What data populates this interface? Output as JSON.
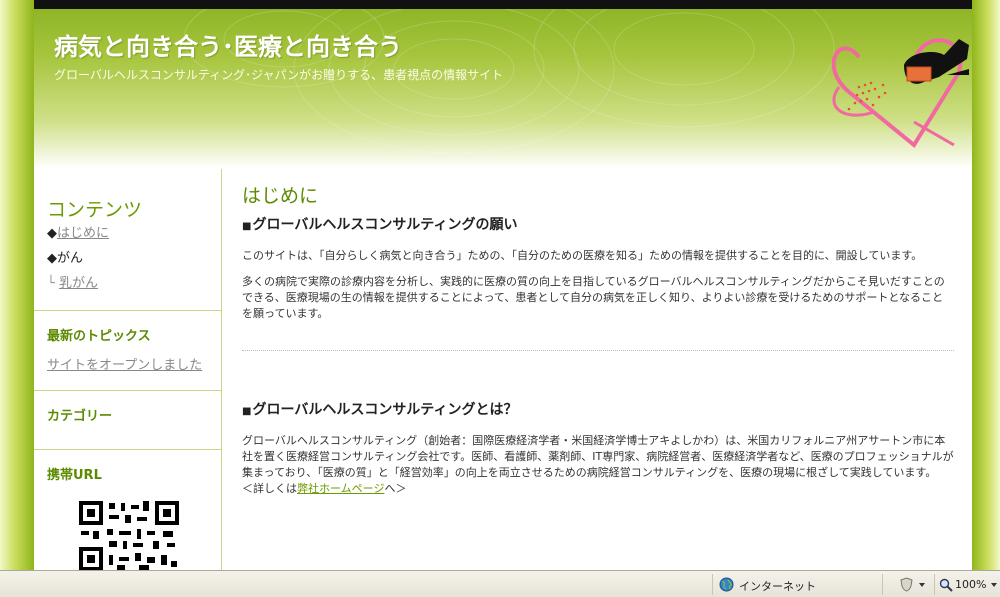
{
  "header": {
    "title": "病気と向き合う･医療と向き合う",
    "subtitle": "グローバルヘルスコンサルティング･ジャパンがお贈りする、患者視点の情報サイト"
  },
  "sidebar": {
    "contents_heading": "コンテンツ",
    "nav": [
      {
        "bullet": "◆",
        "label": "はじめに"
      },
      {
        "bullet": "◆",
        "label": "がん"
      },
      {
        "bullet": "└",
        "label": "乳がん"
      }
    ],
    "topics_heading": "最新のトピックス",
    "topics_link": "サイトをオープンしました",
    "category_heading": "カテゴリー",
    "mobile_heading": "携帯URL"
  },
  "content": {
    "page_title": "はじめに",
    "section1_title": "グローバルヘルスコンサルティングの願い",
    "section1_p1": "このサイトは、「自分らしく病気と向き合う」ための、「自分のための医療を知る」ための情報を提供することを目的に、開設しています。",
    "section1_p2": "多くの病院で実際の診療内容を分析し、実践的に医療の質の向上を目指しているグローバルヘルスコンサルティングだからこそ見いだすことのできる、医療現場の生の情報を提供することによって、患者として自分の病気を正しく知り、よりよい診療を受けるためのサポートとなることを願っています。",
    "section2_title": "グローバルヘルスコンサルティングとは？",
    "section2_p1": "グローバルヘルスコンサルティング（創始者：国際医療経済学者・米国経済学博士アキよしかわ）は、米国カリフォルニア州アサートン市に本社を置く医療経営コンサルティング会社です。医師、看護師、薬剤師、IT専門家、病院経営者、医療経済学者など、医療のプロフェッショナルが集まっており、「医療の質」と「経営効率」の向上を両立させるための病院経営コンサルティングを、医療の現場に根ざして実践しています。",
    "more_prefix": "＜詳しくは",
    "more_link": "弊社ホームページ",
    "more_suffix": "へ＞"
  },
  "statusbar": {
    "zone": "インターネット",
    "zoom": "100%"
  },
  "colors": {
    "accent_green": "#6b9b00",
    "header_green": "#8fb527"
  }
}
